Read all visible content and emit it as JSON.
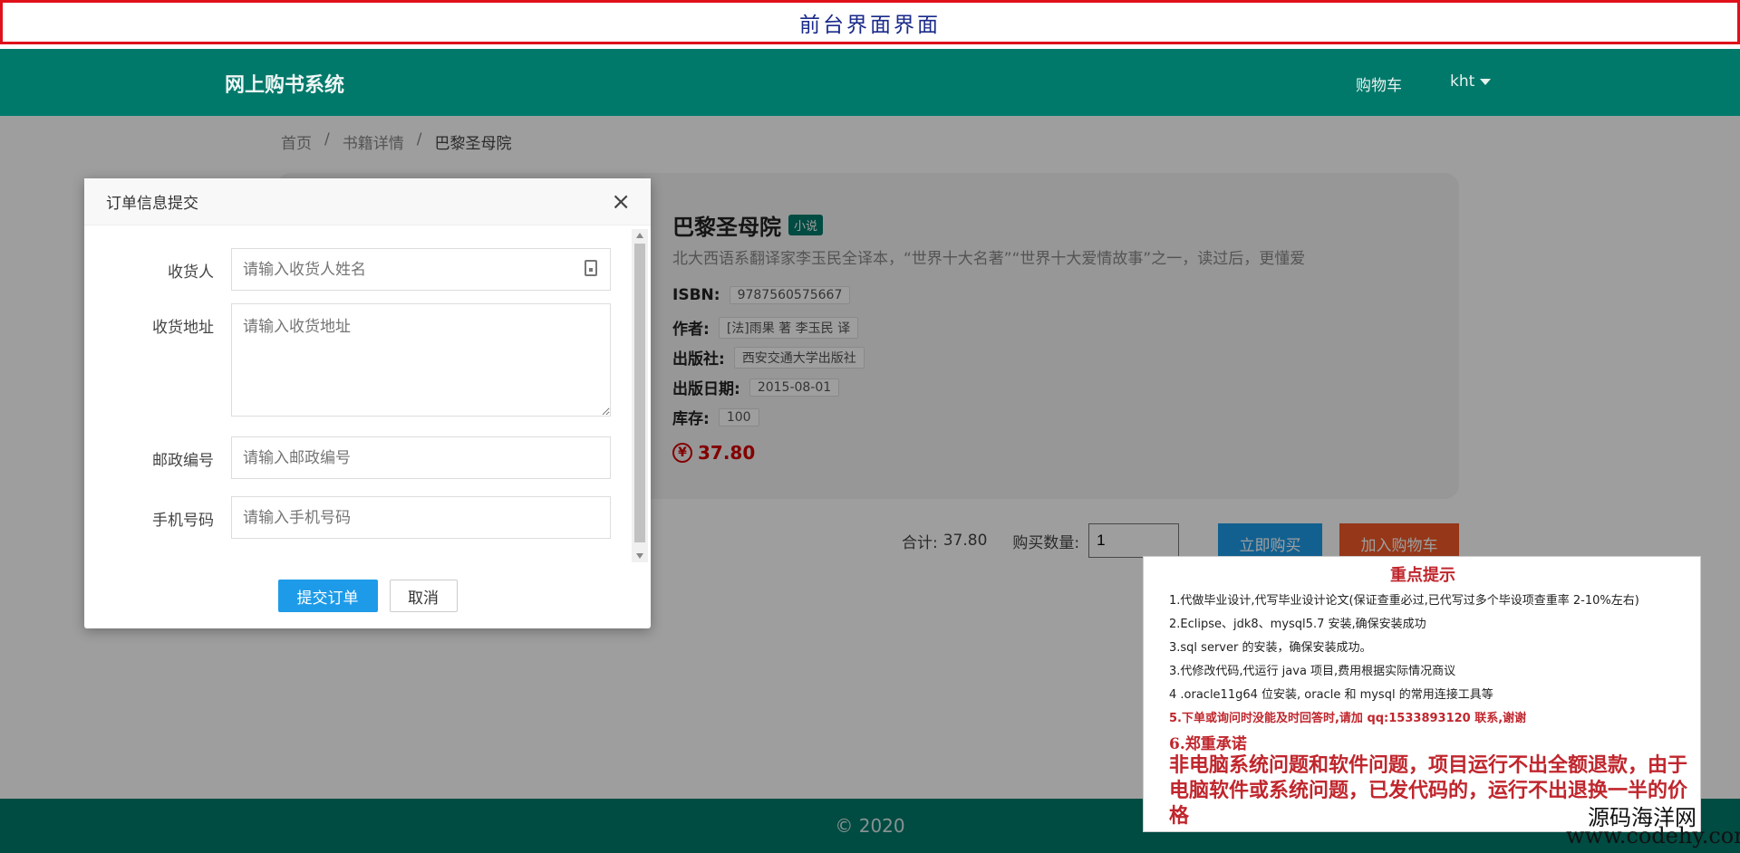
{
  "banner": {
    "title": "前台界面界面"
  },
  "navbar": {
    "brand": "网上购书系统",
    "cart": "购物车",
    "user": "kht"
  },
  "breadcrumb": {
    "home": "首页",
    "detail": "书籍详情",
    "current": "巴黎圣母院",
    "sep": "/"
  },
  "book": {
    "title": "巴黎圣母院",
    "tag": "小说",
    "description": "北大西语系翻译家李玉民全译本，“世界十大名著”“世界十大爱情故事”之一，读过后，更懂爱",
    "isbn_label": "ISBN:",
    "isbn": "9787560575667",
    "author_label": "作者:",
    "author": "[法]雨果 著 李玉民 译",
    "publisher_label": "出版社:",
    "publisher": "西安交通大学出版社",
    "date_label": "出版日期:",
    "date": "2015-08-01",
    "stock_label": "库存:",
    "stock": "100",
    "price": "37.80",
    "currency_icon": "yen-icon"
  },
  "purchase": {
    "total_label": "合计:",
    "total": "37.80",
    "qty_label": "购买数量:",
    "qty": "1",
    "buy_now": "立即购买",
    "add_cart": "加入购物车"
  },
  "footer": {
    "copyright": "© 2020"
  },
  "modal": {
    "title": "订单信息提交",
    "close": "×",
    "fields": {
      "receiver_label": "收货人",
      "receiver_placeholder": "请输入收货人姓名",
      "address_label": "收货地址",
      "address_placeholder": "请输入收货地址",
      "zip_label": "邮政编号",
      "zip_placeholder": "请输入邮政编号",
      "phone_label": "手机号码",
      "phone_placeholder": "请输入手机号码"
    },
    "submit": "提交订单",
    "cancel": "取消"
  },
  "notice": {
    "title": "重点提示",
    "lines": [
      "1.代做毕业设计,代写毕业设计论文(保证查重必过,已代写过多个毕设项查重率 2-10%左右)",
      "2.Eclipse、jdk8、mysql5.7 安装,确保安装成功",
      "3.sql server 的安装，确保安装成功。",
      "3.代修改代码,代运行 java 项目,费用根据实际情况商议",
      "4 .oracle11g64 位安装, oracle 和 mysql 的常用连接工具等",
      "5.下单或询问时没能及时回答时,请加 qq:1533893120 联系,谢谢"
    ],
    "promise_title": "6.郑重承诺",
    "promise_text": "非电脑系统问题和软件问题，项目运行不出全额退款，由于电脑软件或系统问题，已发代码的，运行不出退换一半的价格"
  },
  "watermark": {
    "name": "源码海洋网",
    "url": "www.codehy.com"
  },
  "colors": {
    "primary": "#00796b",
    "blue": "#1e9be8",
    "orange": "#f05a28",
    "price": "#d40000",
    "notice_red": "#c0262d"
  }
}
